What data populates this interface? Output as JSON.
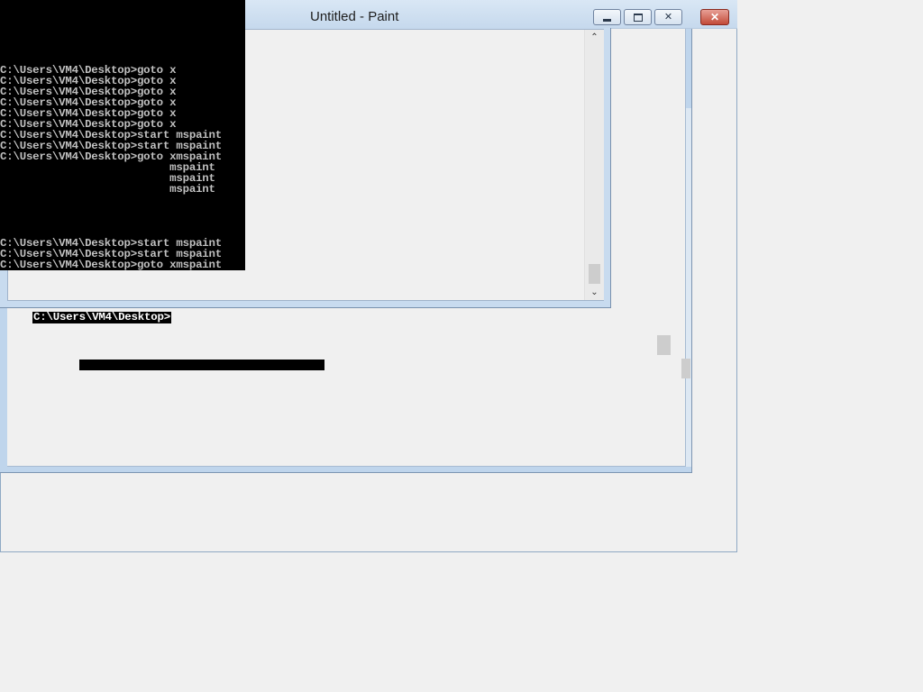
{
  "window": {
    "title": "Untitled - Paint",
    "minimize_label": "▬",
    "restore_label": "❐",
    "close_inactive_label": "✕",
    "close_label": "✕"
  },
  "scrollbar": {
    "up_arrow": "⌃",
    "down_arrow": "⌄"
  },
  "console": {
    "lines": [
      "C:\\Users\\VM4\\Desktop>goto x",
      "C:\\Users\\VM4\\Desktop>goto x",
      "C:\\Users\\VM4\\Desktop>goto x",
      "C:\\Users\\VM4\\Desktop>goto x",
      "C:\\Users\\VM4\\Desktop>goto x",
      "C:\\Users\\VM4\\Desktop>goto x",
      "C:\\Users\\VM4\\Desktop>start mspaint",
      "C:\\Users\\VM4\\Desktop>start mspaint",
      "C:\\Users\\VM4\\Desktop>goto xmspaint",
      "                          mspaint",
      "                          mspaint",
      "                          mspaint",
      "",
      "",
      "",
      "",
      "C:\\Users\\VM4\\Desktop>start mspaint",
      "C:\\Users\\VM4\\Desktop>start mspaint",
      "C:\\Users\\VM4\\Desktop>goto xmspaint"
    ],
    "prompt": "C:\\Users\\VM4\\Desktop>"
  },
  "colors": {
    "console_bg": "#000000",
    "console_text": "#c0c0c0",
    "frame_blue": "#c8dbef",
    "close_red": "#c24a38"
  }
}
